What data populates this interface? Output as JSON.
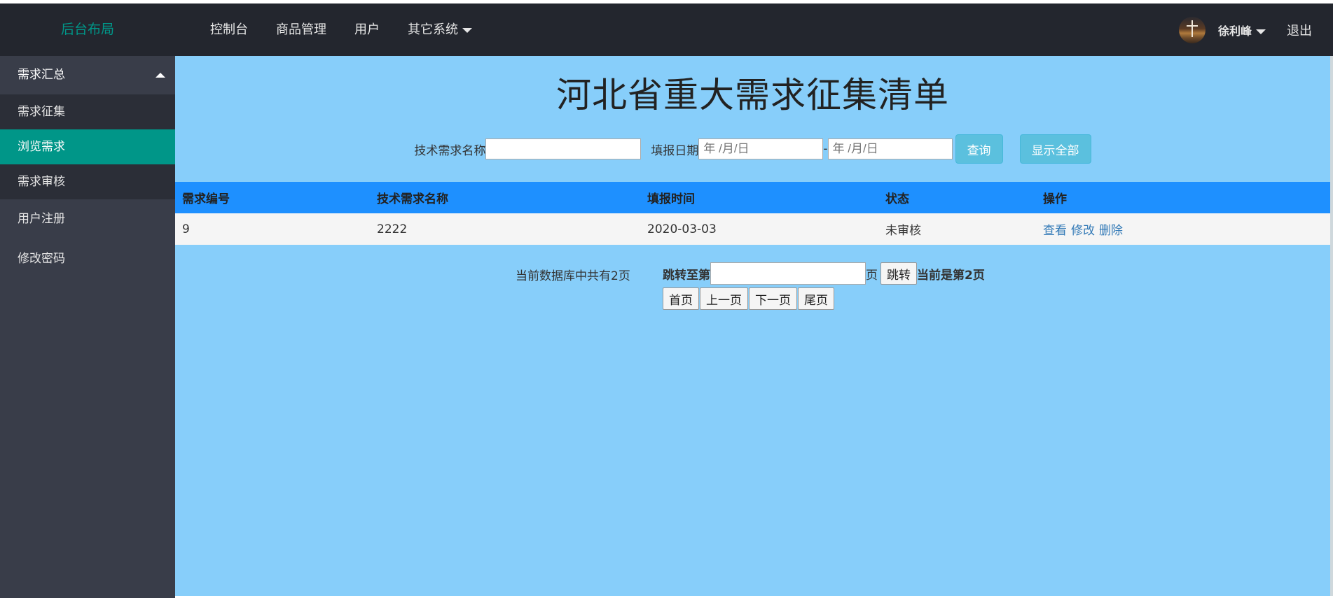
{
  "header": {
    "logo": "后台布局",
    "nav": [
      "控制台",
      "商品管理",
      "用户",
      "其它系统"
    ],
    "user_name": "徐利峰",
    "logout": "退出"
  },
  "sidebar": {
    "group_label": "需求汇总",
    "sub_items": [
      "需求征集",
      "浏览需求",
      "需求审核"
    ],
    "active_sub": "浏览需求",
    "items": [
      "用户注册",
      "修改密码"
    ]
  },
  "main": {
    "title": "河北省重大需求征集清单",
    "search": {
      "name_label": "技术需求名称",
      "name_value": "",
      "date_label": "填报日期",
      "date_start_placeholder": "年 /月/日",
      "date_separator": "-",
      "date_end_placeholder": "年 /月/日",
      "query_button": "查询",
      "show_all_button": "显示全部"
    },
    "table": {
      "headers": [
        "需求编号",
        "技术需求名称",
        "填报时间",
        "状态",
        "操作"
      ],
      "rows": [
        {
          "id": "9",
          "name": "2222",
          "date": "2020-03-03",
          "status": "未审核",
          "actions": [
            "查看",
            "修改",
            "删除"
          ]
        }
      ]
    },
    "pager": {
      "total_text": "当前数据库中共有2页",
      "jump_label": "跳转至第",
      "jump_value": "",
      "page_suffix": "页",
      "jump_button": "跳转",
      "current_text": "当前是第2页",
      "buttons": [
        "首页",
        "上一页",
        "下一页",
        "尾页"
      ]
    }
  },
  "colors": {
    "header_bg": "#23262e",
    "sidebar_bg": "#393d49",
    "active_item": "#009688",
    "main_bg": "#87cefa",
    "table_header": "#1e90ff",
    "button_info": "#5bc0de"
  }
}
